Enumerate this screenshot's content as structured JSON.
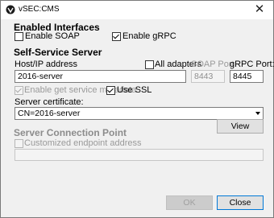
{
  "window": {
    "title": "vSEC:CMS",
    "close_glyph": "✕"
  },
  "enabled_interfaces": {
    "title": "Enabled Interfaces",
    "soap": {
      "label": "Enable SOAP",
      "checked": false
    },
    "grpc": {
      "label": "Enable gRPC",
      "checked": true
    }
  },
  "self_service": {
    "title": "Self-Service Server",
    "host_label": "Host/IP address",
    "all_adapters": {
      "label": "All adapters",
      "checked": false
    },
    "soap_port_label": "SOAP Port",
    "grpc_port_label": "gRPC Port:",
    "host_value": "2016-server",
    "soap_port_value": "8443",
    "grpc_port_value": "8445",
    "get_metadata": {
      "label": "Enable get service metadata",
      "checked": true,
      "disabled": true
    },
    "use_ssl": {
      "label": "Use SSL",
      "checked": true
    },
    "cert_label": "Server certificate:",
    "cert_value": "CN=2016-server",
    "view_button": "View"
  },
  "connection_point": {
    "title": "Server Connection Point",
    "custom_endpoint": {
      "label": "Customized endpoint address",
      "checked": false,
      "disabled": true
    },
    "endpoint_value": ""
  },
  "footer": {
    "ok_label": "OK",
    "close_label": "Close"
  },
  "icons": {
    "app_icon": "app-logo-icon",
    "close_icon": "close-icon",
    "dropdown_icon": "chevron-down-icon"
  }
}
